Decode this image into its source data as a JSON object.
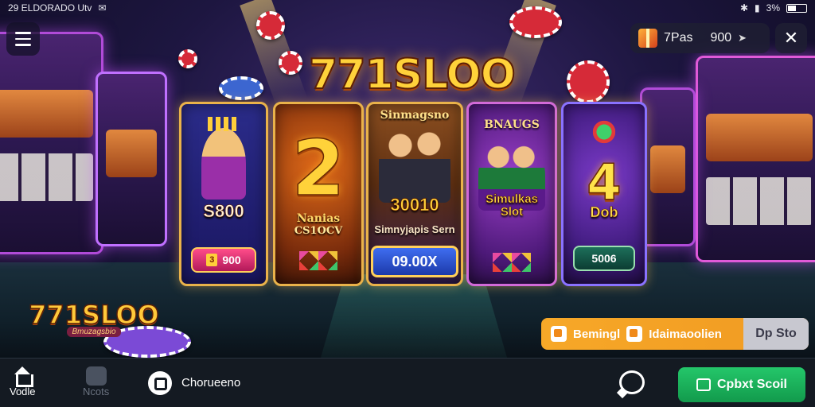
{
  "status_bar": {
    "left_text": "29 ELDORADO Utv",
    "right_text": "3%"
  },
  "header": {
    "balance_label": "7Pas",
    "balance_value": "900"
  },
  "logo": {
    "main": "771SLOO",
    "small_main": "771SLOO",
    "small_sub": "Bmuzagsbio"
  },
  "cards": [
    {
      "amount": "S800",
      "button_label": "900",
      "ticket_label": "3"
    },
    {
      "big_number": "2",
      "title": "Nanias",
      "subtitle": "CS1OCV"
    },
    {
      "top_label": "Sinmagsno",
      "amount": "30010",
      "subtitle": "Simnyjapis Sern",
      "button_label": "09.00X"
    },
    {
      "top_label": "BNAUGS",
      "title_line1": "Simulkas",
      "title_line2": "Slot"
    },
    {
      "big_number": "4",
      "label": "Dob",
      "button_label": "5006"
    }
  ],
  "promo": {
    "left_text": "Bemingl",
    "middle_text": "Idaimaoolien",
    "side_text": "Dp Sto"
  },
  "bottom_nav": {
    "home_label": "Vodle",
    "news_label": "Ncots",
    "search_label": "Chorueeno",
    "cta_label": "Cpbxt Scoil"
  },
  "colors": {
    "accent_gold": "#ffd23a",
    "cta_green": "#24c76a",
    "promo_orange": "#f7a828",
    "card_border": "#e9b24a"
  },
  "icons": {
    "menu": "hamburger-icon",
    "gift": "gift-icon",
    "send": "send-icon",
    "close": "close-icon",
    "home": "home-icon",
    "news": "news-icon",
    "search": "search-icon",
    "chat": "chat-icon"
  }
}
